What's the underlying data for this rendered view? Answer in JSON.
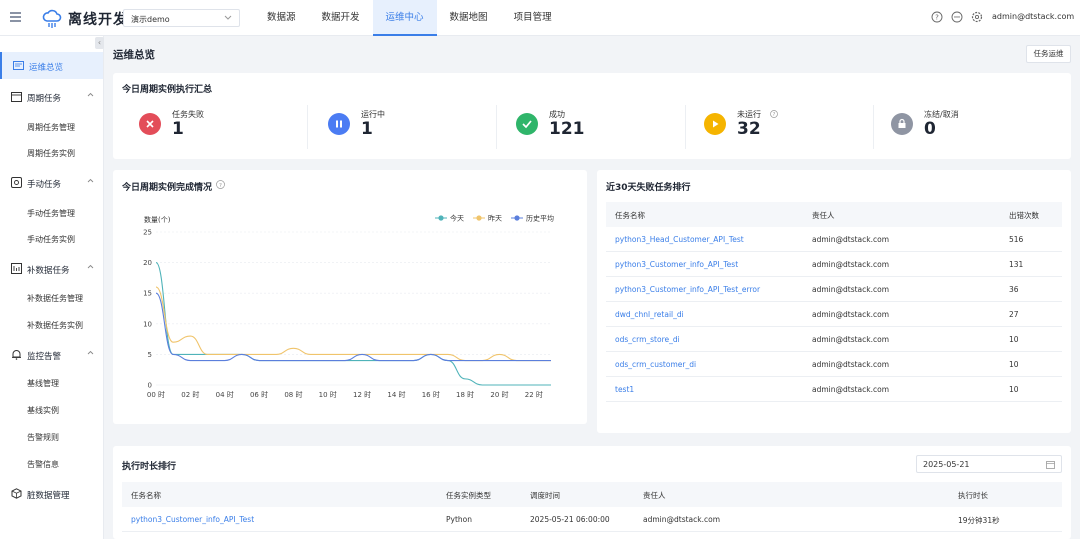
{
  "header": {
    "app_title": "离线开发",
    "project": "演示demo",
    "nav": [
      "数据源",
      "数据开发",
      "运维中心",
      "数据地图",
      "项目管理"
    ],
    "active_nav": "运维中心",
    "user_email": "admin@dtstack.com"
  },
  "sidebar": {
    "items": [
      {
        "label": "运维总览",
        "icon": "dashboard-icon"
      },
      {
        "label": "周期任务",
        "icon": "calendar-icon"
      },
      {
        "label": "手动任务",
        "icon": "hand-task-icon"
      },
      {
        "label": "补数据任务",
        "icon": "backfill-icon"
      },
      {
        "label": "监控告警",
        "icon": "bell-icon"
      },
      {
        "label": "脏数据管理",
        "icon": "cube-icon"
      }
    ],
    "subitems": {
      "periodic": [
        "周期任务管理",
        "周期任务实例"
      ],
      "manual": [
        "手动任务管理",
        "手动任务实例"
      ],
      "backfill": [
        "补数据任务管理",
        "补数据任务实例"
      ],
      "monitor": [
        "基线管理",
        "基线实例",
        "告警规则",
        "告警信息"
      ]
    }
  },
  "main": {
    "title": "运维总览",
    "ops_button": "任务运维"
  },
  "summary": {
    "title": "今日周期实例执行汇总",
    "stats": [
      {
        "label": "任务失败",
        "value": "1",
        "color": "#e34d59"
      },
      {
        "label": "运行中",
        "value": "1",
        "color": "#4b7cf3"
      },
      {
        "label": "成功",
        "value": "121",
        "color": "#2fb56a"
      },
      {
        "label": "未运行",
        "value": "32",
        "color": "#f5b400"
      },
      {
        "label": "冻结/取消",
        "value": "0",
        "color": "#8f95a3"
      }
    ]
  },
  "chart_data": {
    "type": "line",
    "title": "今日周期实例完成情况",
    "ylabel": "数量(个)",
    "ylim": [
      0,
      25
    ],
    "yticks": [
      "0",
      "5",
      "10",
      "15",
      "20",
      "25"
    ],
    "x": [
      "00 时",
      "01 时",
      "02 时",
      "03 时",
      "04 时",
      "05 时",
      "06 时",
      "07 时",
      "08 时",
      "09 时",
      "10 时",
      "11 时",
      "12 时",
      "13 时",
      "14 时",
      "15 时",
      "16 时",
      "17 时",
      "18 时",
      "19 时",
      "20 时",
      "21 时",
      "22 时",
      "23 时"
    ],
    "xticks": [
      "00 时",
      "02 时",
      "04 时",
      "06 时",
      "08 时",
      "10 时",
      "12 时",
      "14 时",
      "16 时",
      "18 时",
      "20 时",
      "22 时"
    ],
    "grid": true,
    "legend": "top-right",
    "series": [
      {
        "name": "今天",
        "color": "#4fb3b9",
        "values": [
          20,
          5,
          5,
          5,
          5,
          5,
          4,
          4,
          4,
          4,
          4,
          4,
          4,
          4,
          4,
          4,
          5,
          4,
          1,
          0,
          0,
          0,
          0,
          0
        ]
      },
      {
        "name": "昨天",
        "color": "#f0c46b",
        "values": [
          16,
          7,
          8,
          5,
          5,
          5,
          5,
          5,
          6,
          5,
          5,
          5,
          5,
          5,
          5,
          5,
          5,
          5,
          4,
          4,
          5,
          4,
          4,
          4
        ]
      },
      {
        "name": "历史平均",
        "color": "#5b7fdc",
        "values": [
          15,
          5,
          4,
          4,
          4,
          5,
          4,
          4,
          4,
          4,
          4,
          4,
          5,
          4,
          4,
          4,
          5,
          4,
          4,
          4,
          4,
          4,
          4,
          4
        ]
      }
    ]
  },
  "failed_rank": {
    "title": "近30天失败任务排行",
    "columns": [
      "任务名称",
      "责任人",
      "出错次数"
    ],
    "rows": [
      [
        "python3_Head_Customer_API_Test",
        "admin@dtstack.com",
        "516"
      ],
      [
        "python3_Customer_info_API_Test",
        "admin@dtstack.com",
        "131"
      ],
      [
        "python3_Customer_info_API_Test_error",
        "admin@dtstack.com",
        "36"
      ],
      [
        "dwd_chnl_retail_di",
        "admin@dtstack.com",
        "27"
      ],
      [
        "ods_crm_store_di",
        "admin@dtstack.com",
        "10"
      ],
      [
        "ods_crm_customer_di",
        "admin@dtstack.com",
        "10"
      ],
      [
        "test1",
        "admin@dtstack.com",
        "10"
      ]
    ]
  },
  "duration_rank": {
    "title": "执行时长排行",
    "date": "2025-05-21",
    "columns": [
      "任务名称",
      "任务实例类型",
      "调度时间",
      "责任人",
      "执行时长"
    ],
    "rows": [
      [
        "python3_Customer_info_API_Test",
        "Python",
        "2025-05-21 06:00:00",
        "admin@dtstack.com",
        "19分钟31秒"
      ]
    ]
  }
}
